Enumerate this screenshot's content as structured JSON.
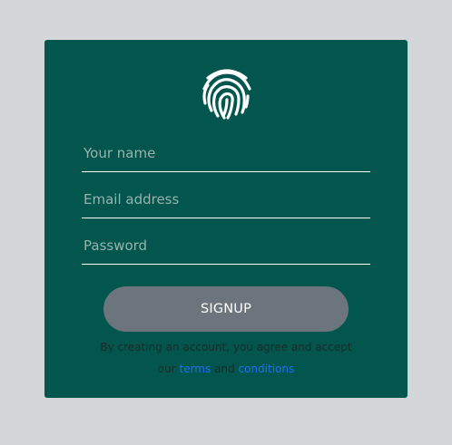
{
  "form": {
    "name_placeholder": "Your name",
    "email_placeholder": "Email address",
    "password_placeholder": "Password",
    "submit_label": "SIGNUP"
  },
  "consent": {
    "text_line1": "By creating an account, you agree and accept",
    "text_our": "our",
    "terms_link": "terms",
    "text_and": "and",
    "conditions_link": "conditions"
  },
  "colors": {
    "page_background": "#d3d7da",
    "card_background": "#02564d",
    "button_background": "#6c757d",
    "link_color": "#1d6ff2"
  },
  "icons": {
    "logo": "fingerprint-icon"
  }
}
